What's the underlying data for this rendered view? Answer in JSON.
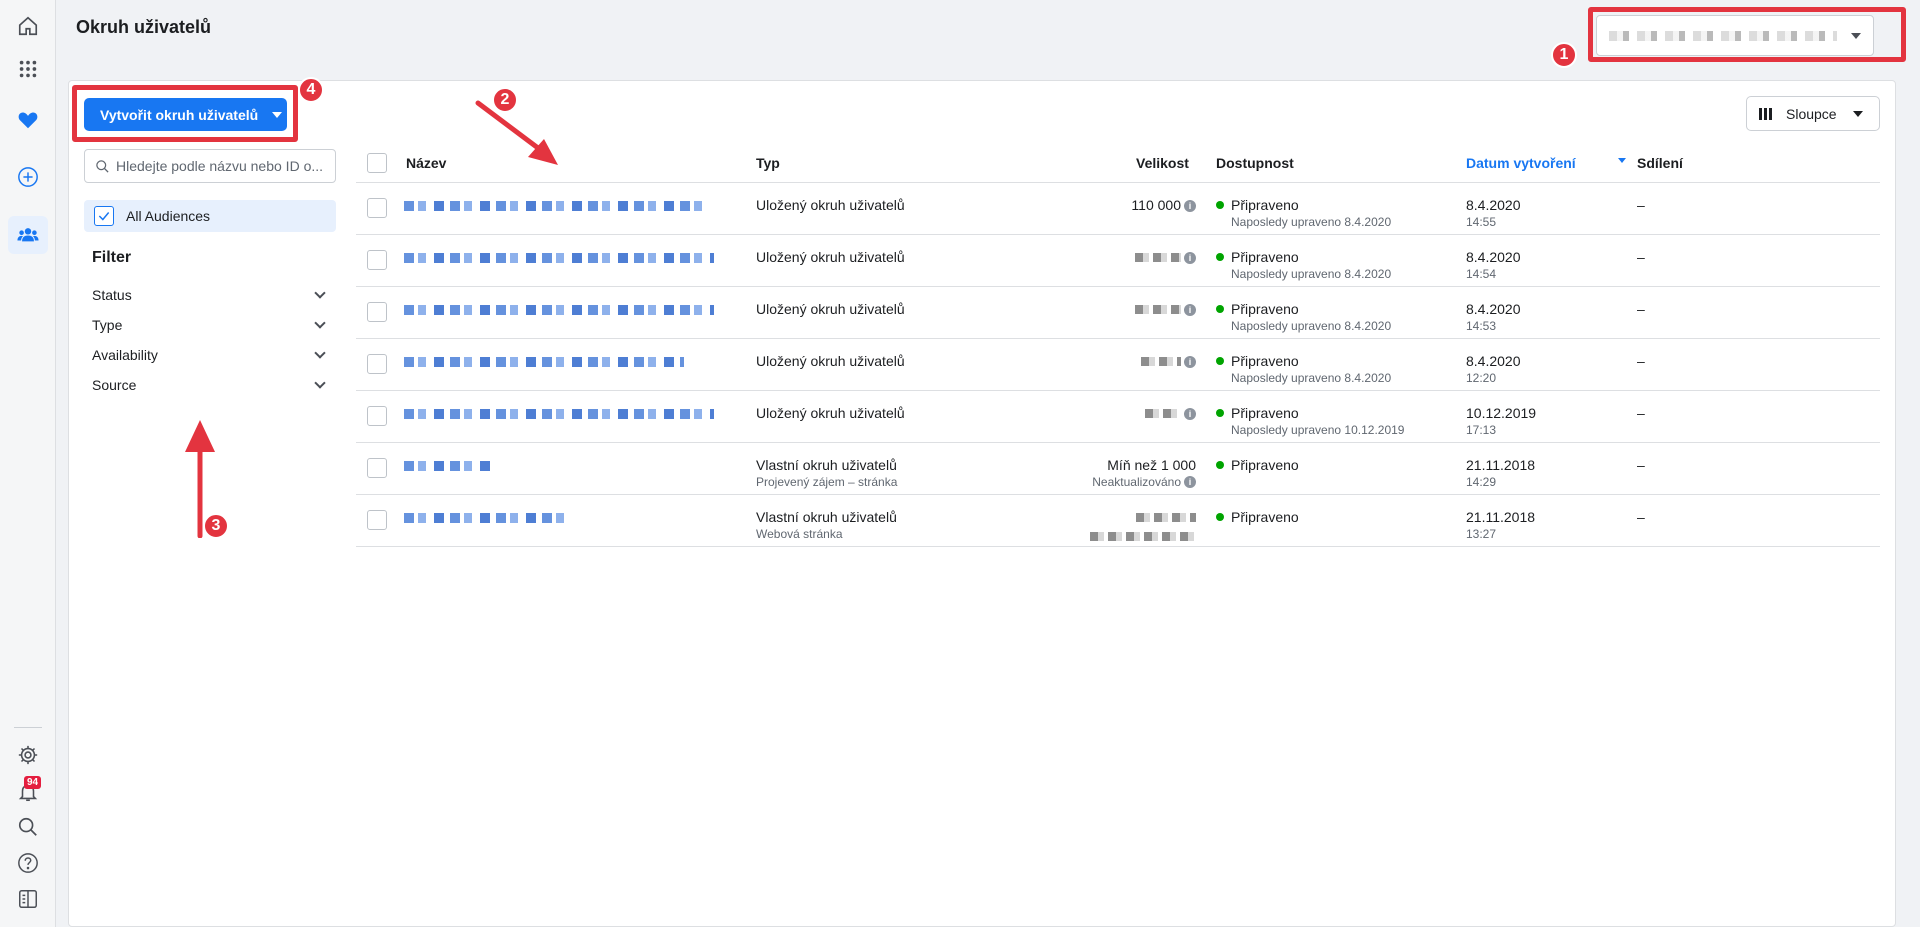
{
  "page_title": "Okruh uživatelů",
  "create_button": "Vytvořit okruh uživatelů",
  "search_placeholder": "Hledejte podle názvu nebo ID o...",
  "all_audiences": "All Audiences",
  "filter": {
    "title": "Filter",
    "items": [
      "Status",
      "Type",
      "Availability",
      "Source"
    ]
  },
  "columns_button": "Sloupce",
  "notification_count": "94",
  "annotations": [
    "1",
    "2",
    "3",
    "4"
  ],
  "colors": {
    "accent": "#1877f2",
    "highlight": "#e3343f",
    "status_ready": "#00a400"
  },
  "table": {
    "headers": {
      "name": "Název",
      "type": "Typ",
      "size": "Velikost",
      "availability": "Dostupnost",
      "created": "Datum vytvoření",
      "sharing": "Sdílení"
    },
    "rows": [
      {
        "type": "Uložený okruh uživatelů",
        "type_sub": "",
        "size": "110 000",
        "size_sub": "",
        "status": "Připraveno",
        "status_sub": "Naposledy upraveno 8.4.2020",
        "date": "8.4.2020",
        "time": "14:55",
        "sharing": "–"
      },
      {
        "type": "Uložený okruh uživatelů",
        "type_sub": "",
        "size": "",
        "size_sub": "",
        "status": "Připraveno",
        "status_sub": "Naposledy upraveno 8.4.2020",
        "date": "8.4.2020",
        "time": "14:54",
        "sharing": "–"
      },
      {
        "type": "Uložený okruh uživatelů",
        "type_sub": "",
        "size": "",
        "size_sub": "",
        "status": "Připraveno",
        "status_sub": "Naposledy upraveno 8.4.2020",
        "date": "8.4.2020",
        "time": "14:53",
        "sharing": "–"
      },
      {
        "type": "Uložený okruh uživatelů",
        "type_sub": "",
        "size": "",
        "size_sub": "",
        "status": "Připraveno",
        "status_sub": "Naposledy upraveno 8.4.2020",
        "date": "8.4.2020",
        "time": "12:20",
        "sharing": "–"
      },
      {
        "type": "Uložený okruh uživatelů",
        "type_sub": "",
        "size": "",
        "size_sub": "",
        "status": "Připraveno",
        "status_sub": "Naposledy upraveno 10.12.2019",
        "date": "10.12.2019",
        "time": "17:13",
        "sharing": "–"
      },
      {
        "type": "Vlastní okruh uživatelů",
        "type_sub": "Projevený zájem – stránka",
        "size": "Míň než 1 000",
        "size_sub": "Neaktualizováno",
        "status": "Připraveno",
        "status_sub": "",
        "date": "21.11.2018",
        "time": "14:29",
        "sharing": "–"
      },
      {
        "type": "Vlastní okruh uživatelů",
        "type_sub": "Webová stránka",
        "size": "",
        "size_sub": "",
        "status": "Připraveno",
        "status_sub": "",
        "date": "21.11.2018",
        "time": "13:27",
        "sharing": "–"
      }
    ]
  }
}
